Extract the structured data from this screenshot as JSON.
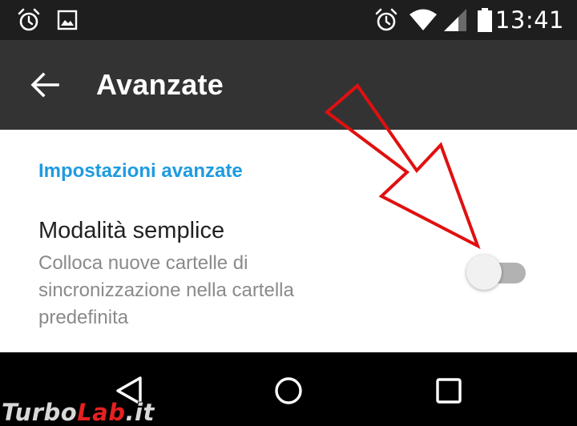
{
  "status_bar": {
    "time": "13:41",
    "left_icons": [
      "alarm-icon",
      "image-notification-icon"
    ],
    "right_icons": [
      "alarm-icon",
      "wifi-icon",
      "cellular-signal-icon",
      "battery-icon"
    ]
  },
  "app_bar": {
    "back_icon": "arrow-back-icon",
    "title": "Avanzate",
    "background": "#333333"
  },
  "settings": {
    "section_header": "Impostazioni avanzate",
    "accent_color": "#1e9be0",
    "preference": {
      "title": "Modalità semplice",
      "summary": "Colloca nuove cartelle di sincronizzazione nella cartella predefinita",
      "toggle_on": false
    }
  },
  "annotation": {
    "arrow_color": "#e01010"
  },
  "nav_bar": {
    "icons": [
      "back-triangle-icon",
      "home-circle-icon",
      "recents-square-icon"
    ]
  },
  "watermark": {
    "part1": "Turbo",
    "part2": "Lab",
    "part3": ".it"
  }
}
